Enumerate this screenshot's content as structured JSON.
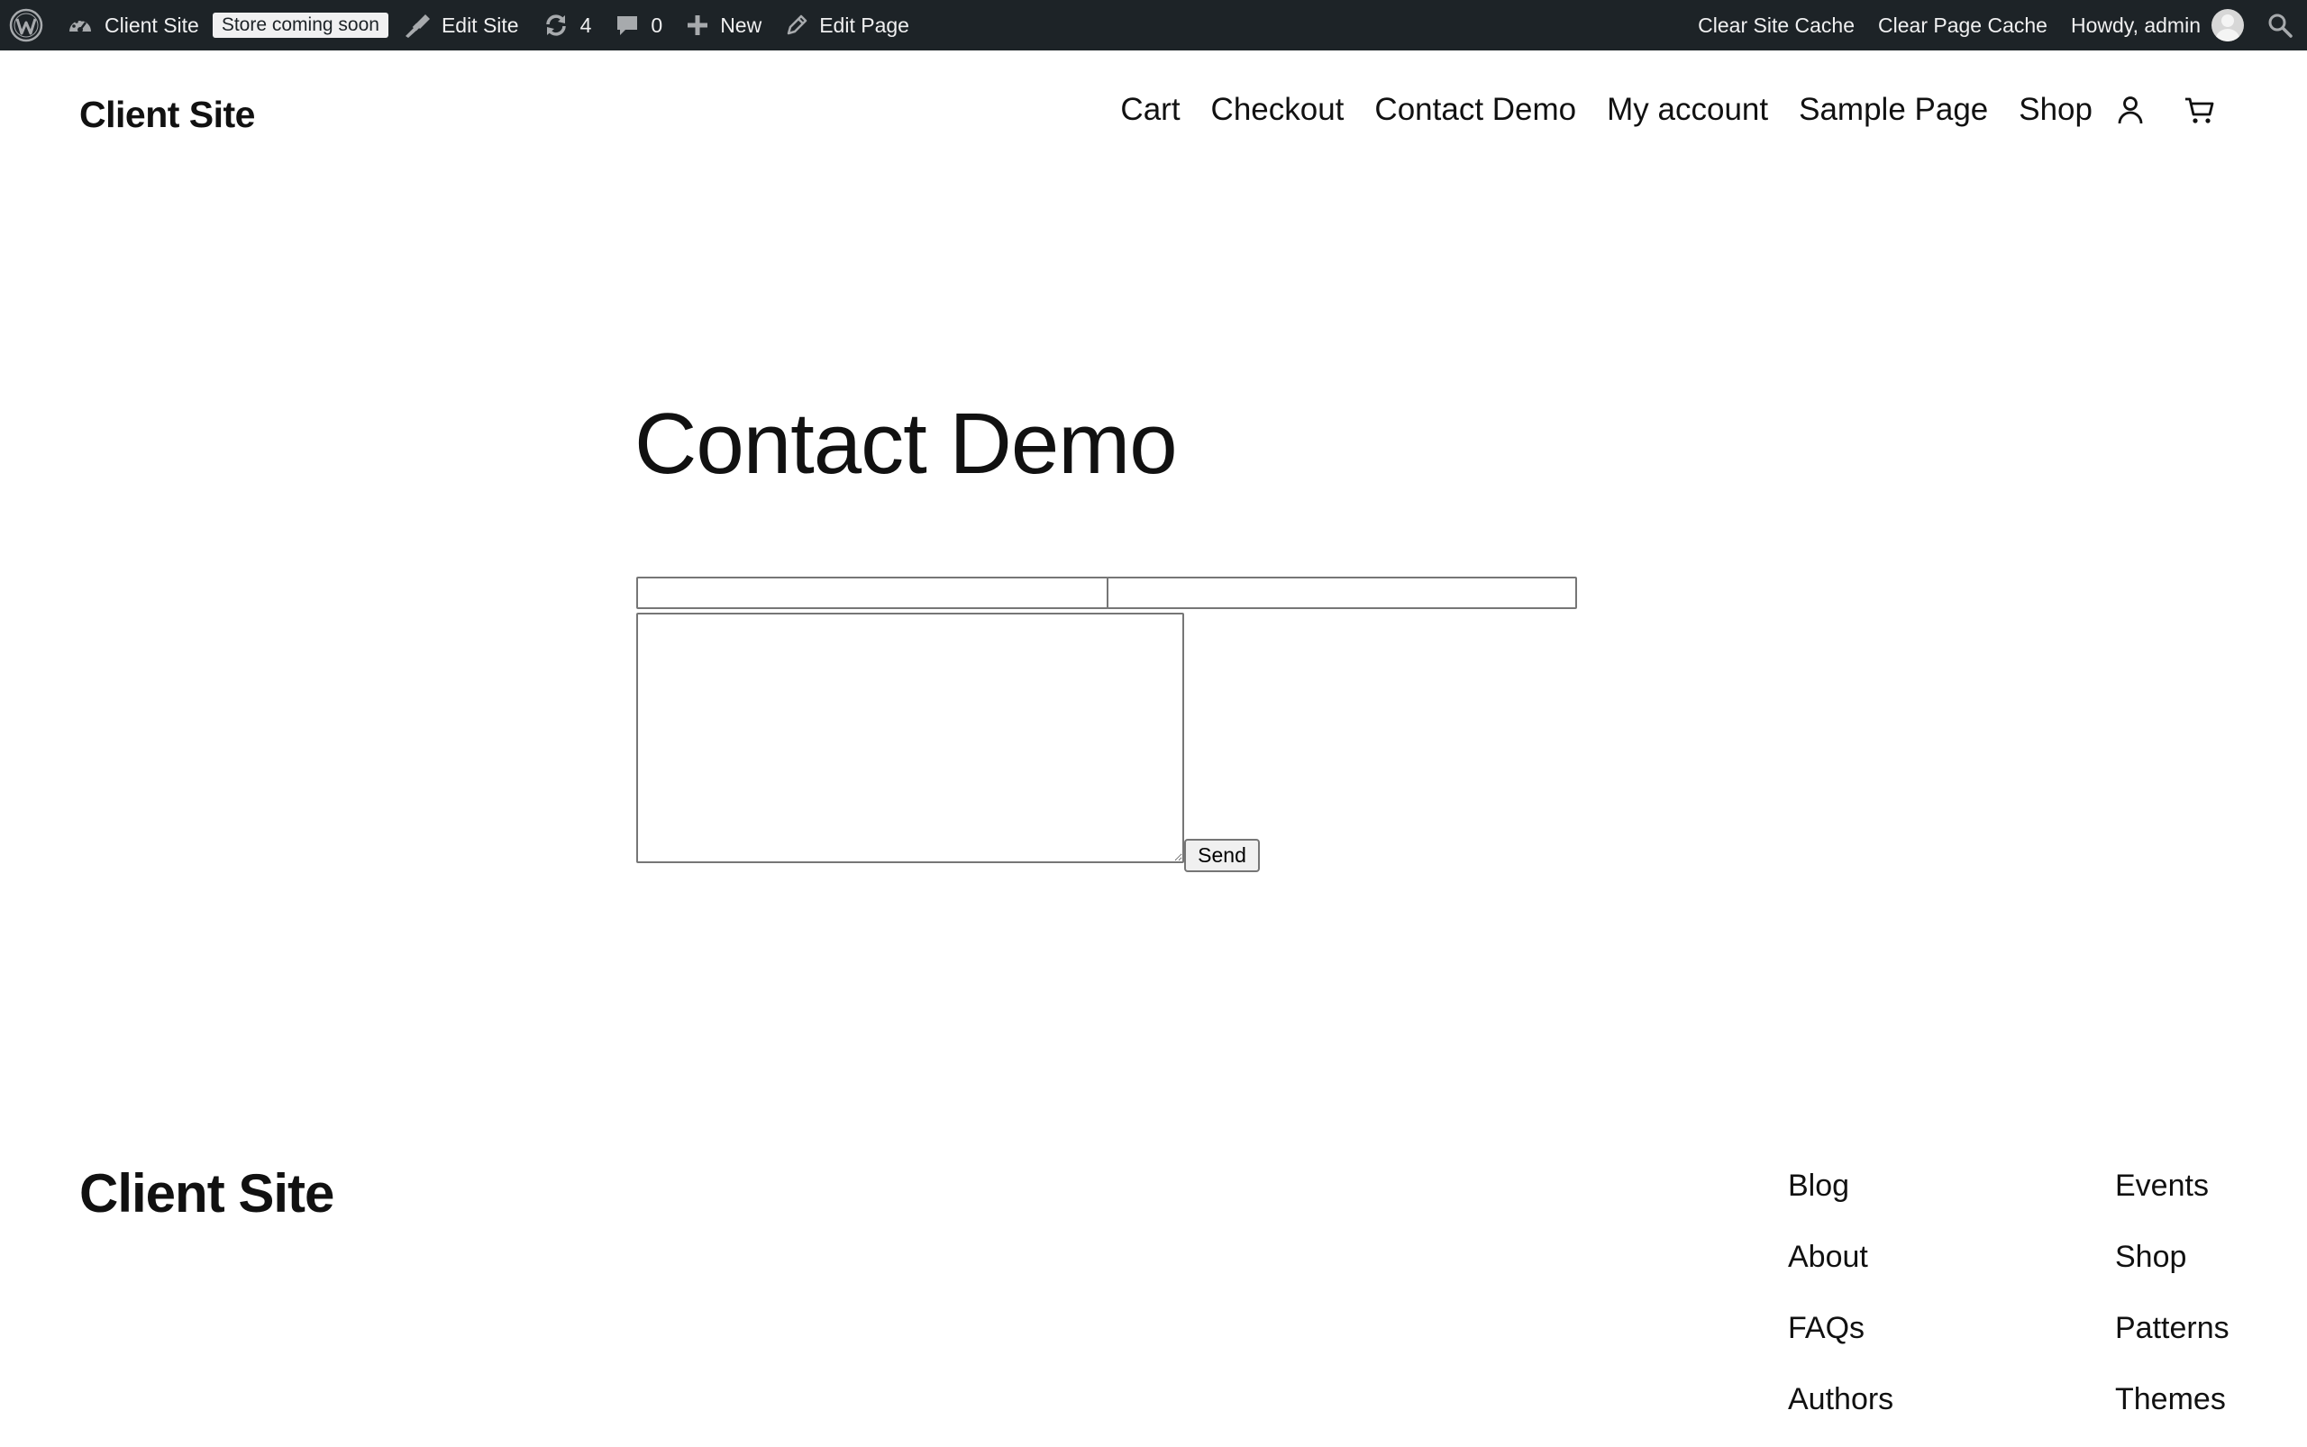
{
  "admin_bar": {
    "site_name": "Client Site",
    "store_badge": "Store coming soon",
    "edit_site": "Edit Site",
    "updates_count": "4",
    "comments_count": "0",
    "new_label": "New",
    "edit_page": "Edit Page",
    "clear_site_cache": "Clear Site Cache",
    "clear_page_cache": "Clear Page Cache",
    "greeting": "Howdy, admin",
    "bar_color": "#1d2327"
  },
  "header": {
    "site_title": "Client Site",
    "nav": [
      {
        "label": "Cart"
      },
      {
        "label": "Checkout"
      },
      {
        "label": "Contact Demo"
      },
      {
        "label": "My account"
      },
      {
        "label": "Sample Page"
      },
      {
        "label": "Shop"
      }
    ],
    "icons": [
      "account-icon",
      "cart-icon"
    ]
  },
  "main": {
    "title": "Contact Demo",
    "form": {
      "name_value": "",
      "email_value": "",
      "message_value": "",
      "send_label": "Send"
    }
  },
  "footer": {
    "site_title": "Client Site",
    "column_1": [
      {
        "label": "Blog"
      },
      {
        "label": "About"
      },
      {
        "label": "FAQs"
      },
      {
        "label": "Authors"
      }
    ],
    "column_2": [
      {
        "label": "Events"
      },
      {
        "label": "Shop"
      },
      {
        "label": "Patterns"
      },
      {
        "label": "Themes"
      }
    ]
  }
}
